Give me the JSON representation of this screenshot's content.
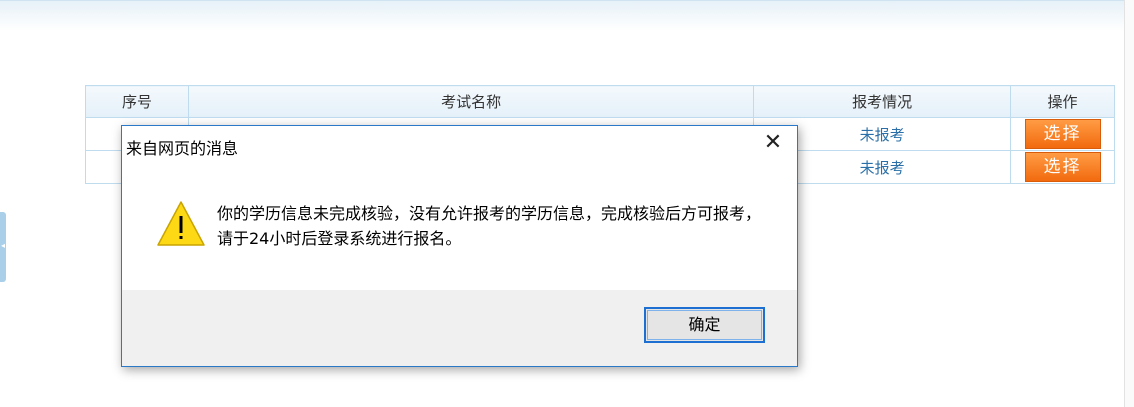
{
  "table": {
    "headers": [
      "序号",
      "考试名称",
      "报考情况",
      "操作"
    ],
    "rows": [
      {
        "index": "",
        "exam_name": "",
        "status": "未报考",
        "action": "选择"
      },
      {
        "index": "",
        "exam_name": "",
        "status": "未报考",
        "action": "选择"
      }
    ]
  },
  "dialog": {
    "title": "来自网页的消息",
    "close_icon": "close-icon",
    "warning_icon": "warning-icon",
    "message": "你的学历信息未完成核验，没有允许报考的学历信息，完成核验后方可报考，请于24小时后登录系统进行报名。",
    "ok_label": "确定"
  },
  "colors": {
    "accent_orange": "#f26a0e",
    "status_link": "#2a6fa8",
    "dialog_border": "#2a78c8",
    "header_bg": "#e4f0f9"
  }
}
